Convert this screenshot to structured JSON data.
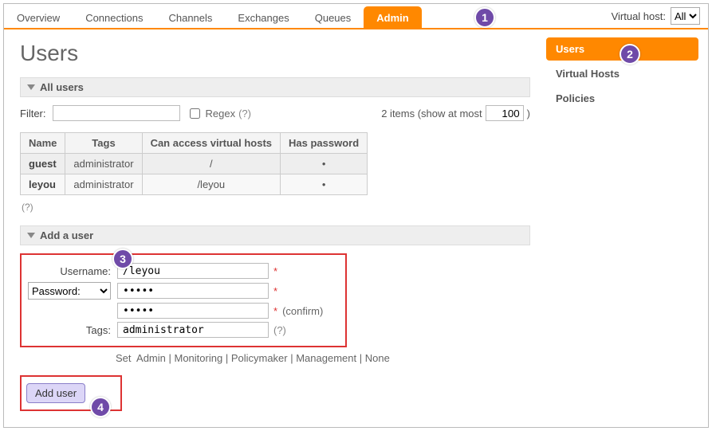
{
  "nav": {
    "tabs": [
      "Overview",
      "Connections",
      "Channels",
      "Exchanges",
      "Queues",
      "Admin"
    ],
    "active_index": 5,
    "vhost_label": "Virtual host:",
    "vhost_value": "All"
  },
  "page": {
    "title": "Users"
  },
  "sidebar": {
    "items": [
      "Users",
      "Virtual Hosts",
      "Policies"
    ],
    "active_index": 0
  },
  "all_users": {
    "heading": "All users",
    "filter_label": "Filter:",
    "filter_value": "",
    "regex_label": "Regex",
    "regex_hint": "(?)",
    "count_text": "2 items (show at most",
    "page_size": "100",
    "count_close": ")",
    "columns": [
      "Name",
      "Tags",
      "Can access virtual hosts",
      "Has password"
    ],
    "rows": [
      {
        "name": "guest",
        "tags": "administrator",
        "vhosts": "/",
        "has_pw": "•"
      },
      {
        "name": "leyou",
        "tags": "administrator",
        "vhosts": "/leyou",
        "has_pw": "•"
      }
    ],
    "footer_hint": "(?)"
  },
  "add_user": {
    "heading": "Add a user",
    "username_label": "Username:",
    "username_value": "/leyou",
    "password_label": "Password:",
    "password_value": "•••••",
    "password_confirm_value": "•••••",
    "confirm_label": "(confirm)",
    "tags_label": "Tags:",
    "tags_value": "administrator",
    "tags_hint": "(?)",
    "setline_prefix": "Set",
    "setline_opts": [
      "Admin",
      "Monitoring",
      "Policymaker",
      "Management",
      "None"
    ],
    "button_label": "Add user"
  },
  "callouts": {
    "1": "1",
    "2": "2",
    "3": "3",
    "4": "4"
  }
}
